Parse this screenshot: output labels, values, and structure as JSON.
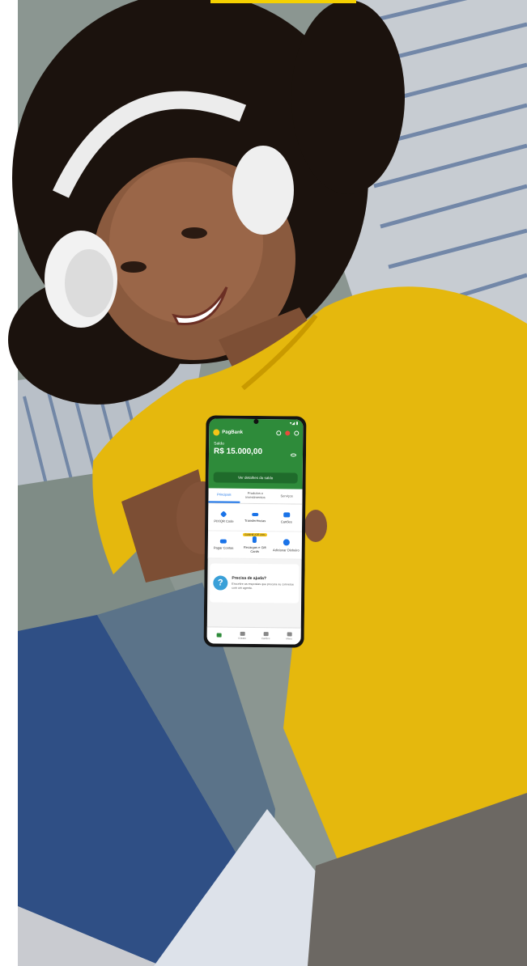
{
  "app": {
    "brand": "PagBank",
    "balance_label": "Saldo",
    "balance_value": "R$ 15.000,00",
    "extract_button": "Ver detalhes do saldo",
    "tabs": [
      {
        "label": "Principais",
        "active": true
      },
      {
        "label": "Produtos e investimentos",
        "active": false
      },
      {
        "label": "Serviços",
        "active": false
      }
    ],
    "actions": [
      {
        "label": "PIX/QR Code",
        "icon": "pix-icon",
        "badge": ""
      },
      {
        "label": "Transferências",
        "icon": "transfer-icon",
        "badge": ""
      },
      {
        "label": "Cartões",
        "icon": "card-icon",
        "badge": ""
      },
      {
        "label": "Pagar Contas",
        "icon": "barcode-icon",
        "badge": ""
      },
      {
        "label": "Recargas e Gift Cards",
        "icon": "phone-icon",
        "badge": "GANHE ATÉ 20%"
      },
      {
        "label": "Adicionar Dinheiro",
        "icon": "money-add-icon",
        "badge": ""
      }
    ],
    "help": {
      "title": "Precisa de ajuda?",
      "text": "Encontre as respostas que procura ou converse com um agente."
    },
    "nav": [
      {
        "label": "",
        "icon": "home-icon",
        "active": true
      },
      {
        "label": "Extrato",
        "icon": "list-icon",
        "active": false
      },
      {
        "label": "Cartões",
        "icon": "card-icon",
        "active": false
      },
      {
        "label": "Menu",
        "icon": "menu-icon",
        "active": false
      }
    ],
    "colors": {
      "brand_green": "#2e8b3a",
      "accent_yellow": "#f5c518",
      "tab_blue": "#1a73e8"
    }
  }
}
